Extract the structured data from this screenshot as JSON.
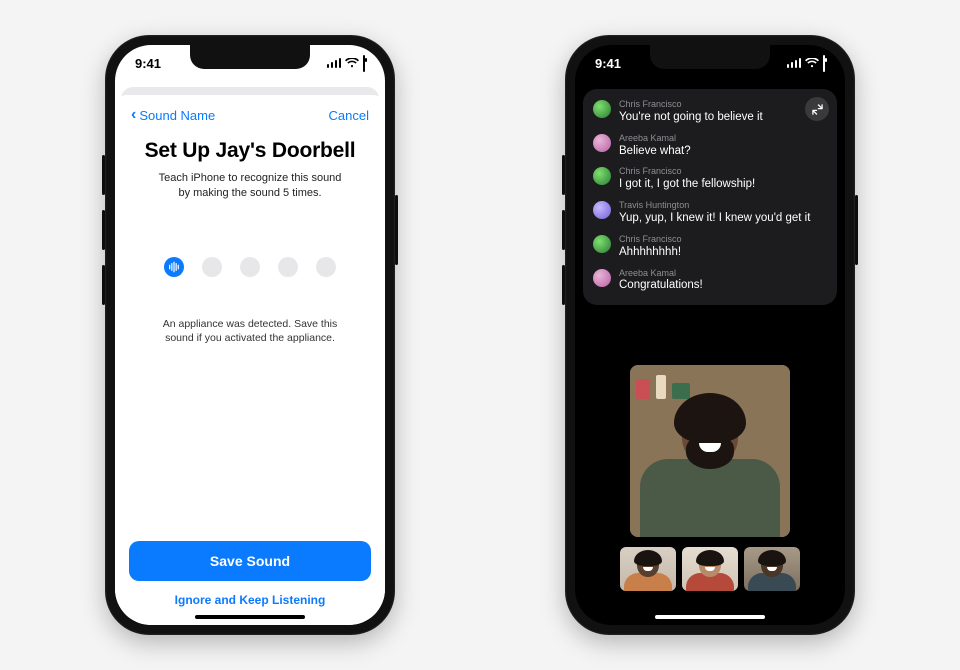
{
  "status": {
    "time": "9:41"
  },
  "left": {
    "nav": {
      "back": "Sound Name",
      "cancel": "Cancel"
    },
    "title": "Set Up Jay's Doorbell",
    "subtitle": "Teach iPhone to recognize this sound by making the sound 5 times.",
    "progress": {
      "total": 5,
      "completed": 1
    },
    "detection": "An appliance was detected. Save this sound if you activated the appliance.",
    "primary": "Save Sound",
    "secondary": "Ignore and Keep Listening"
  },
  "right": {
    "captions": [
      {
        "avatar": "a",
        "name": "Chris Francisco",
        "msg": "You're not going to believe it"
      },
      {
        "avatar": "b",
        "name": "Areeba Kamal",
        "msg": "Believe what?"
      },
      {
        "avatar": "a",
        "name": "Chris Francisco",
        "msg": "I got it, I got the fellowship!"
      },
      {
        "avatar": "c",
        "name": "Travis Huntington",
        "msg": "Yup, yup, I knew it! I knew you'd get it"
      },
      {
        "avatar": "a",
        "name": "Chris Francisco",
        "msg": "Ahhhhhhhh!"
      },
      {
        "avatar": "b",
        "name": "Areeba Kamal",
        "msg": "Congratulations!"
      }
    ]
  }
}
